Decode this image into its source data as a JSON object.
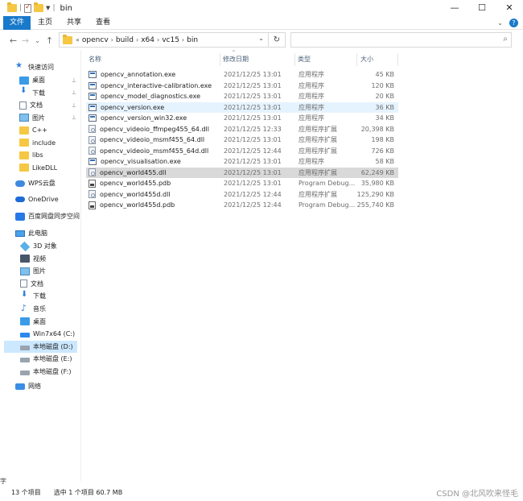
{
  "window": {
    "title": "bin",
    "controls": {
      "minimize": "—",
      "maximize": "☐",
      "close": "✕"
    }
  },
  "ribbon": {
    "tabs": [
      "文件",
      "主页",
      "共享",
      "查看"
    ],
    "collapse_caret": "⌄",
    "help": "?"
  },
  "nav": {
    "back": "←",
    "forward": "→",
    "recent": "⌄",
    "up": "↑",
    "breadcrumb_prefix": "«",
    "breadcrumb": [
      "opencv",
      "build",
      "x64",
      "vc15",
      "bin"
    ],
    "refresh": "↻",
    "search_placeholder": "",
    "search_icon": "search-icon"
  },
  "sidebar": {
    "quick_access": "快速访问",
    "quick_items": [
      {
        "label": "桌面",
        "icon": "desktop-icon",
        "pinned": true
      },
      {
        "label": "下载",
        "icon": "download-icon",
        "pinned": true
      },
      {
        "label": "文档",
        "icon": "document-icon",
        "pinned": true
      },
      {
        "label": "图片",
        "icon": "picture-icon",
        "pinned": true
      },
      {
        "label": "C++",
        "icon": "folder-icon",
        "pinned": false
      },
      {
        "label": "include",
        "icon": "folder-icon",
        "pinned": false
      },
      {
        "label": "libs",
        "icon": "folder-icon",
        "pinned": false
      },
      {
        "label": "LikeDLL",
        "icon": "folder-icon",
        "pinned": false
      }
    ],
    "wps": "WPS云盘",
    "onedrive": "OneDrive",
    "baidu": "百度网盘同步空间",
    "this_pc": "此电脑",
    "pc_items": [
      {
        "label": "3D 对象",
        "icon": "3d-objects-icon"
      },
      {
        "label": "视频",
        "icon": "video-icon"
      },
      {
        "label": "图片",
        "icon": "picture-icon"
      },
      {
        "label": "文档",
        "icon": "document-icon"
      },
      {
        "label": "下载",
        "icon": "download-icon"
      },
      {
        "label": "音乐",
        "icon": "music-icon"
      },
      {
        "label": "桌面",
        "icon": "desktop-icon"
      },
      {
        "label": "Win7x64 (C:)",
        "icon": "windows-drive-icon"
      },
      {
        "label": "本地磁盘 (D:)",
        "icon": "drive-icon",
        "selected": true
      },
      {
        "label": "本地磁盘 (E:)",
        "icon": "drive-icon"
      },
      {
        "label": "本地磁盘 (F:)",
        "icon": "drive-icon"
      }
    ],
    "network": "网络",
    "pin_glyph": "📌"
  },
  "files": {
    "columns": {
      "name": "名称",
      "date": "修改日期",
      "type": "类型",
      "size": "大小"
    },
    "sort_caret": "^",
    "rows": [
      {
        "name": "opencv_annotation.exe",
        "date": "2021/12/25 13:01",
        "type": "应用程序",
        "size": "45 KB",
        "kind": "exe"
      },
      {
        "name": "opencv_interactive-calibration.exe",
        "date": "2021/12/25 13:01",
        "type": "应用程序",
        "size": "120 KB",
        "kind": "exe"
      },
      {
        "name": "opencv_model_diagnostics.exe",
        "date": "2021/12/25 13:01",
        "type": "应用程序",
        "size": "20 KB",
        "kind": "exe"
      },
      {
        "name": "opencv_version.exe",
        "date": "2021/12/25 13:01",
        "type": "应用程序",
        "size": "36 KB",
        "kind": "exe",
        "state": "hover"
      },
      {
        "name": "opencv_version_win32.exe",
        "date": "2021/12/25 13:01",
        "type": "应用程序",
        "size": "34 KB",
        "kind": "exe"
      },
      {
        "name": "opencv_videoio_ffmpeg455_64.dll",
        "date": "2021/12/25 12:33",
        "type": "应用程序扩展",
        "size": "20,398 KB",
        "kind": "dll"
      },
      {
        "name": "opencv_videoio_msmf455_64.dll",
        "date": "2021/12/25 13:01",
        "type": "应用程序扩展",
        "size": "198 KB",
        "kind": "dll"
      },
      {
        "name": "opencv_videoio_msmf455_64d.dll",
        "date": "2021/12/25 12:44",
        "type": "应用程序扩展",
        "size": "726 KB",
        "kind": "dll"
      },
      {
        "name": "opencv_visualisation.exe",
        "date": "2021/12/25 13:01",
        "type": "应用程序",
        "size": "58 KB",
        "kind": "exe"
      },
      {
        "name": "opencv_world455.dll",
        "date": "2021/12/25 13:01",
        "type": "应用程序扩展",
        "size": "62,249 KB",
        "kind": "dll",
        "state": "selected"
      },
      {
        "name": "opencv_world455.pdb",
        "date": "2021/12/25 13:01",
        "type": "Program Debug...",
        "size": "35,980 KB",
        "kind": "pdb"
      },
      {
        "name": "opencv_world455d.dll",
        "date": "2021/12/25 12:44",
        "type": "应用程序扩展",
        "size": "125,290 KB",
        "kind": "dll"
      },
      {
        "name": "opencv_world455d.pdb",
        "date": "2021/12/25 12:44",
        "type": "Program Debug...",
        "size": "255,740 KB",
        "kind": "pdb"
      }
    ]
  },
  "status": {
    "count": "13 个项目",
    "selection": "选中 1 个项目  60.7 MB",
    "watermark": "CSDN @北风吹来怪毛",
    "left_fragment": "字"
  }
}
